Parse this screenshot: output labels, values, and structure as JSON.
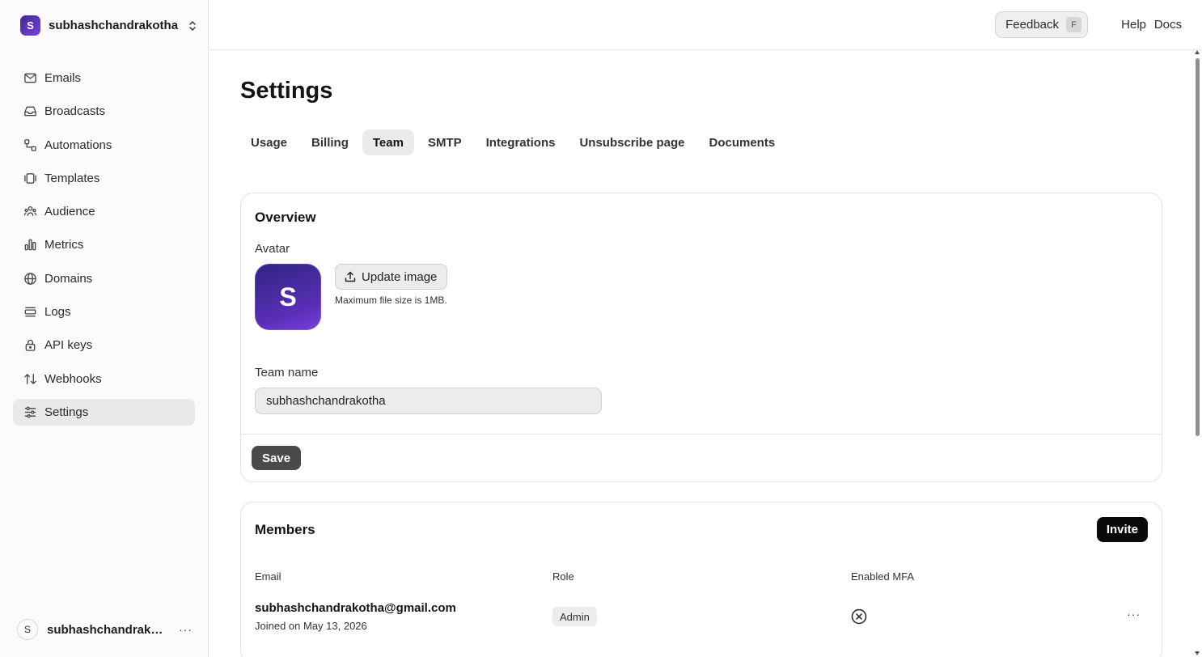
{
  "team": {
    "initial": "S",
    "name": "subhashchandrakotha"
  },
  "nav": [
    {
      "label": "Emails",
      "icon": "mail-icon"
    },
    {
      "label": "Broadcasts",
      "icon": "inbox-icon"
    },
    {
      "label": "Automations",
      "icon": "workflow-icon"
    },
    {
      "label": "Templates",
      "icon": "templates-icon"
    },
    {
      "label": "Audience",
      "icon": "users-icon"
    },
    {
      "label": "Metrics",
      "icon": "bar-chart-icon"
    },
    {
      "label": "Domains",
      "icon": "globe-icon"
    },
    {
      "label": "Logs",
      "icon": "logs-icon"
    },
    {
      "label": "API keys",
      "icon": "lock-icon"
    },
    {
      "label": "Webhooks",
      "icon": "arrows-up-down-icon"
    },
    {
      "label": "Settings",
      "icon": "sliders-icon",
      "active": true
    }
  ],
  "user": {
    "initial": "S",
    "name": "subhashchandrakotha",
    "more": "···"
  },
  "topbar": {
    "feedback_label": "Feedback",
    "feedback_shortcut": "F",
    "help_label": "Help",
    "docs_label": "Docs"
  },
  "page": {
    "title": "Settings"
  },
  "tabs": [
    {
      "label": "Usage"
    },
    {
      "label": "Billing"
    },
    {
      "label": "Team",
      "active": true
    },
    {
      "label": "SMTP"
    },
    {
      "label": "Integrations"
    },
    {
      "label": "Unsubscribe page"
    },
    {
      "label": "Documents"
    }
  ],
  "overview": {
    "title": "Overview",
    "avatar_label": "Avatar",
    "avatar_initial": "S",
    "update_image_label": "Update image",
    "file_size_hint": "Maximum file size is 1MB.",
    "team_name_label": "Team name",
    "team_name_value": "subhashchandrakotha",
    "save_label": "Save"
  },
  "members": {
    "title": "Members",
    "invite_label": "Invite",
    "columns": {
      "email": "Email",
      "role": "Role",
      "mfa": "Enabled MFA"
    },
    "rows": [
      {
        "email": "subhashchandrakotha@gmail.com",
        "joined": "Joined on May 13, 2026",
        "role": "Admin",
        "mfa_enabled": false,
        "more": "···"
      }
    ]
  },
  "colors": {
    "accent_purple": "#5a2fb8",
    "primary_button": "#0a0a0a",
    "save_button": "#4a4a4a",
    "active_bg": "#e9e9e9"
  }
}
